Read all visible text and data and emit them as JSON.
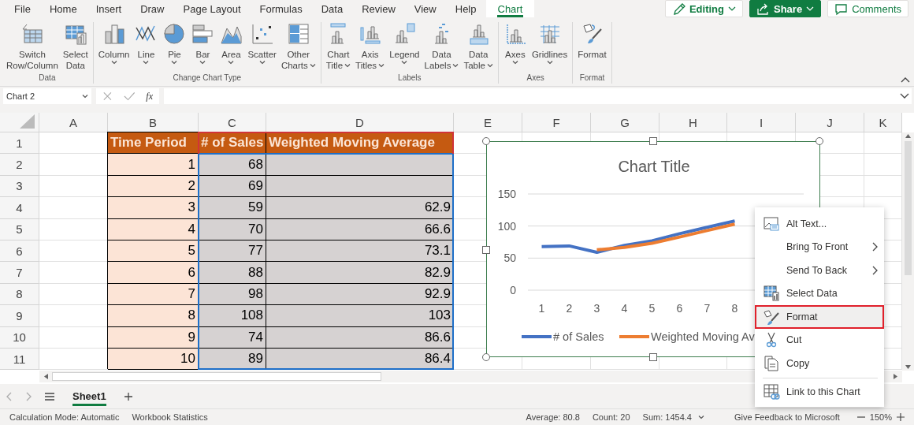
{
  "ribbon_tabs": [
    {
      "label": "File",
      "selected": false
    },
    {
      "label": "Home",
      "selected": false
    },
    {
      "label": "Insert",
      "selected": false
    },
    {
      "label": "Draw",
      "selected": false
    },
    {
      "label": "Page Layout",
      "selected": false
    },
    {
      "label": "Formulas",
      "selected": false
    },
    {
      "label": "Data",
      "selected": false
    },
    {
      "label": "Review",
      "selected": false
    },
    {
      "label": "View",
      "selected": false
    },
    {
      "label": "Help",
      "selected": false
    },
    {
      "label": "Chart",
      "selected": true
    }
  ],
  "header_buttons": [
    {
      "label": "Editing",
      "kind": "mode"
    },
    {
      "label": "Share",
      "kind": "primary"
    },
    {
      "label": "Comments",
      "kind": "plain"
    }
  ],
  "ribbon_groups": [
    {
      "label": "Data",
      "buttons": [
        {
          "lines": [
            "Switch",
            "Row/Column"
          ],
          "dropdown": false
        },
        {
          "lines": [
            "Select",
            "Data"
          ],
          "dropdown": false
        }
      ]
    },
    {
      "label": "Change Chart Type",
      "buttons": [
        {
          "lines": [
            "Column"
          ],
          "dropdown": true
        },
        {
          "lines": [
            "Line"
          ],
          "dropdown": true
        },
        {
          "lines": [
            "Pie"
          ],
          "dropdown": true
        },
        {
          "lines": [
            "Bar"
          ],
          "dropdown": true
        },
        {
          "lines": [
            "Area"
          ],
          "dropdown": true
        },
        {
          "lines": [
            "Scatter"
          ],
          "dropdown": true
        },
        {
          "lines": [
            "Other",
            "Charts"
          ],
          "dropdown": true
        }
      ]
    },
    {
      "label": "Labels",
      "buttons": [
        {
          "lines": [
            "Chart",
            "Title"
          ],
          "dropdown": true
        },
        {
          "lines": [
            "Axis",
            "Titles"
          ],
          "dropdown": true
        },
        {
          "lines": [
            "Legend"
          ],
          "dropdown": true
        },
        {
          "lines": [
            "Data",
            "Labels"
          ],
          "dropdown": true
        },
        {
          "lines": [
            "Data",
            "Table"
          ],
          "dropdown": true
        }
      ]
    },
    {
      "label": "Axes",
      "buttons": [
        {
          "lines": [
            "Axes"
          ],
          "dropdown": true
        },
        {
          "lines": [
            "Gridlines"
          ],
          "dropdown": true
        }
      ]
    },
    {
      "label": "Format",
      "buttons": [
        {
          "lines": [
            "Format"
          ],
          "dropdown": false
        }
      ]
    }
  ],
  "formula_bar": {
    "name_box": "Chart 2",
    "function_label": "fx"
  },
  "sheet": {
    "columns": [
      "A",
      "B",
      "C",
      "D",
      "E",
      "F",
      "G",
      "H",
      "I",
      "J",
      "K"
    ],
    "rows": [
      {
        "label": "1",
        "cells": [
          {
            "kind": "label",
            "text": "Time Period"
          },
          {
            "kind": "series-name",
            "text": "# of Sales"
          },
          {
            "kind": "series-name",
            "text": "Weighted Moving Average"
          }
        ]
      },
      {
        "label": "2",
        "cells": [
          {
            "kind": "input",
            "text": "1"
          },
          {
            "kind": "series",
            "text": "68"
          },
          {
            "kind": "series"
          }
        ]
      },
      {
        "label": "3",
        "cells": [
          {
            "kind": "input",
            "text": "2"
          },
          {
            "kind": "series",
            "text": "69"
          },
          {
            "kind": "series"
          }
        ]
      },
      {
        "label": "4",
        "cells": [
          {
            "kind": "input",
            "text": "3"
          },
          {
            "kind": "series",
            "text": "59"
          },
          {
            "kind": "series",
            "text": "62.9"
          }
        ]
      },
      {
        "label": "5",
        "cells": [
          {
            "kind": "input",
            "text": "4"
          },
          {
            "kind": "series",
            "text": "70"
          },
          {
            "kind": "series",
            "text": "66.6"
          }
        ]
      },
      {
        "label": "6",
        "cells": [
          {
            "kind": "input",
            "text": "5"
          },
          {
            "kind": "series",
            "text": "77"
          },
          {
            "kind": "series",
            "text": "73.1"
          }
        ]
      },
      {
        "label": "7",
        "cells": [
          {
            "kind": "input",
            "text": "6"
          },
          {
            "kind": "series",
            "text": "88"
          },
          {
            "kind": "series",
            "text": "82.9"
          }
        ]
      },
      {
        "label": "8",
        "cells": [
          {
            "kind": "input",
            "text": "7"
          },
          {
            "kind": "series",
            "text": "98"
          },
          {
            "kind": "series",
            "text": "92.9"
          }
        ]
      },
      {
        "label": "9",
        "cells": [
          {
            "kind": "input",
            "text": "8"
          },
          {
            "kind": "series",
            "text": "108"
          },
          {
            "kind": "series",
            "text": "103"
          }
        ]
      },
      {
        "label": "10",
        "cells": [
          {
            "kind": "input",
            "text": "9"
          },
          {
            "kind": "series",
            "text": "74"
          },
          {
            "kind": "series",
            "text": "86.6"
          }
        ]
      },
      {
        "label": "11",
        "cells": [
          {
            "kind": "input",
            "text": "10"
          },
          {
            "kind": "series",
            "text": "89"
          },
          {
            "kind": "series",
            "text": "86.4"
          }
        ]
      }
    ]
  },
  "chart": {
    "chart_data": {
      "type": "line",
      "title": "Chart Title",
      "categories": [
        "1",
        "2",
        "3",
        "4",
        "5",
        "6",
        "7",
        "8"
      ],
      "series": [
        {
          "name": "# of Sales",
          "color": "#4472c4",
          "values": [
            68,
            69,
            59,
            70,
            77,
            88,
            98,
            108
          ]
        },
        {
          "name": "Weighted Moving Av",
          "color": "#ed7d31",
          "values": [
            null,
            null,
            62.9,
            66.6,
            73.1,
            82.9,
            92.9,
            103
          ]
        }
      ],
      "ylim": [
        0,
        150
      ],
      "yticks": [
        0,
        50,
        100,
        150
      ],
      "legend": true
    }
  },
  "context_menu": {
    "items": [
      {
        "kind": "item",
        "label": "Alt Text...",
        "selected": false,
        "submenu": false
      },
      {
        "kind": "item",
        "label": "Bring To Front",
        "selected": false,
        "submenu": true
      },
      {
        "kind": "item",
        "label": "Send To Back",
        "selected": false,
        "submenu": true
      },
      {
        "kind": "item",
        "label": "Select Data",
        "selected": false,
        "submenu": false
      },
      {
        "kind": "item",
        "label": "Format",
        "selected": true,
        "submenu": false
      },
      {
        "kind": "item",
        "label": "Cut",
        "selected": false,
        "submenu": false
      },
      {
        "kind": "item",
        "label": "Copy",
        "selected": false,
        "submenu": false
      },
      {
        "kind": "separator"
      },
      {
        "kind": "item",
        "label": "Link to this Chart",
        "selected": false,
        "submenu": false
      }
    ]
  },
  "sheet_tabs": [
    {
      "label": "Sheet1",
      "selected": true
    }
  ],
  "status_bar": {
    "calculation": "Calculation Mode: Automatic",
    "statistics": "Workbook Statistics",
    "average": "Average: 80.8",
    "count": "Count: 20",
    "sum": "Sum: 1454.4",
    "feedback": "Give Feedback to Microsoft",
    "zoom": "150%"
  }
}
